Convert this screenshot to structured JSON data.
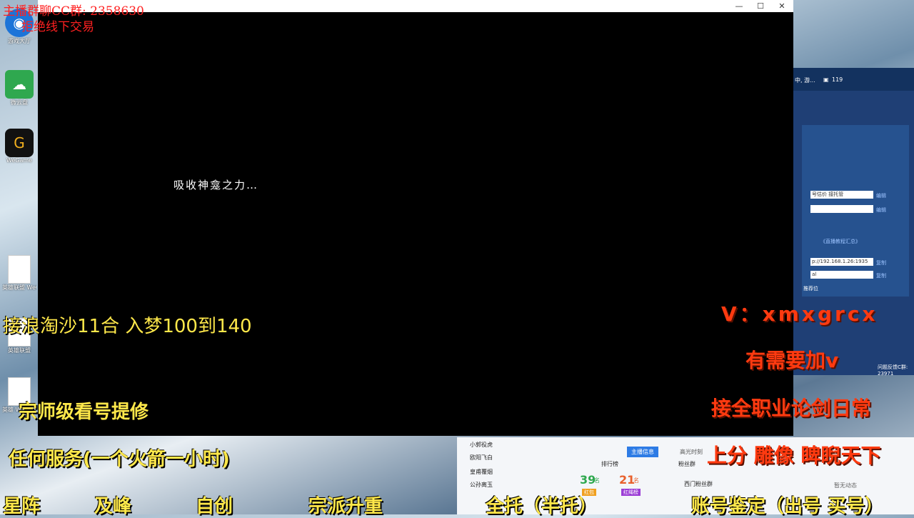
{
  "desktop": {
    "icons": [
      {
        "label": "游戏大厅",
        "icon": "game-hall-icon"
      },
      {
        "label": "微云盘",
        "icon": "cloud-icon"
      },
      {
        "label": "WeGame",
        "icon": "wegame-icon"
      }
    ],
    "files": [
      {
        "label": "英雄联盟 WeGame版"
      },
      {
        "label": "英雄联盟"
      },
      {
        "label": "英雄 WeGame版"
      }
    ]
  },
  "game_window": {
    "title": "",
    "buttons": {
      "minimize": "—",
      "maximize": "☐",
      "close": "✕"
    },
    "loading_text": "吸收神龛之力…"
  },
  "background_app": {
    "bar_text": "中, 游...",
    "viewer_count": "119",
    "fields": [
      "号估价 接托管",
      ""
    ],
    "edit_label": "编辑",
    "tutorial_link": "《直播教程汇总》",
    "server_url": "p://192.168.1.26:1935",
    "key_field": "al",
    "copy_label": "复制",
    "recommend_label": "推荐位",
    "feedback": "问题反馈C群: 23971"
  },
  "stream_panel": {
    "list": [
      "小郭役虎",
      "欧阳飞白",
      "皇甫覆烟",
      "公孙离玉"
    ],
    "ranking_label": "排行榜",
    "fans_label": "粉丝群",
    "tabs": [
      "主播信息",
      "高光时刻"
    ],
    "stats": [
      {
        "value": "39",
        "unit": "名",
        "badge": "红包"
      },
      {
        "value": "21",
        "unit": "名",
        "badge": "红绳榜"
      }
    ],
    "fan_group": "西门粉丝群",
    "no_activity": "暂无动态"
  },
  "overlay": {
    "top_left_group": "主播群聊CC群: 2358630",
    "top_left_notice": "拒绝线下交易",
    "line_1": "接浪淘沙11合  入梦100到140",
    "line_2": "宗师级看号提修",
    "line_3": "任何服务(一个火箭一小时)",
    "bottom_items": [
      "星阵",
      "及峰",
      "自创",
      "宗派升重",
      "全托（半托）",
      "账号鉴定（出号 买号）"
    ],
    "right_contact": "V：xmxgrcx",
    "right_add": "有需要加v",
    "right_service": "接全职业论剑日常",
    "right_bottom": "上分   雕像   睥睨天下"
  },
  "colors": {
    "overlay_yellow": "#ffe84a",
    "overlay_orange": "#ff3a10",
    "overlay_red": "#ff2020",
    "window_bg": "#000000"
  }
}
